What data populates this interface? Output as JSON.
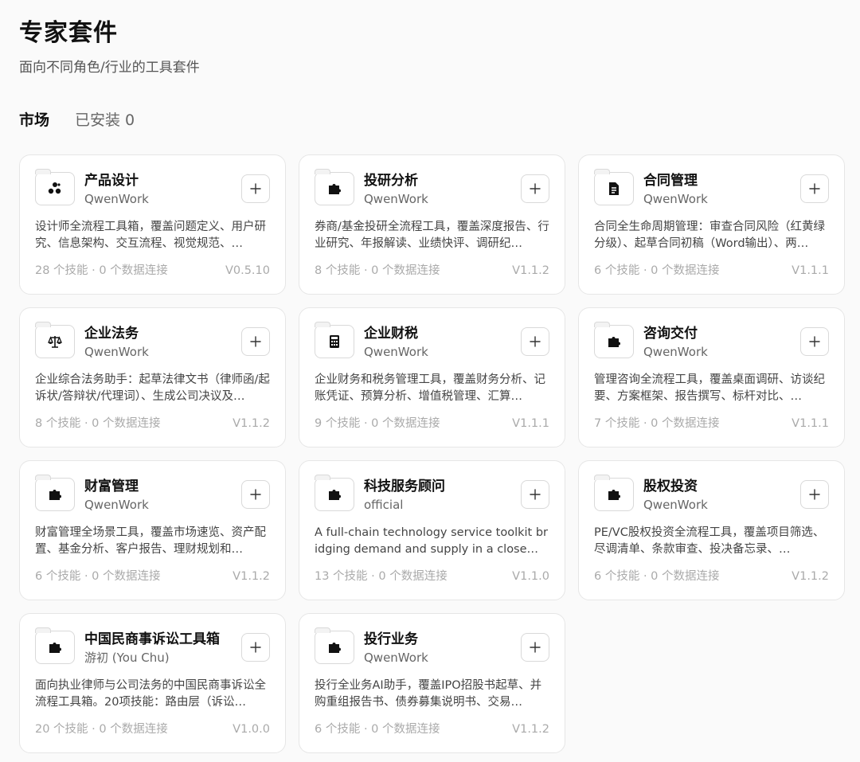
{
  "page": {
    "title": "专家套件",
    "subtitle": "面向不同角色/行业的工具套件"
  },
  "tabs": [
    {
      "label": "市场",
      "count": ""
    },
    {
      "label": "已安装",
      "count": "0"
    }
  ],
  "cards": [
    {
      "title": "产品设计",
      "author": "QwenWork",
      "icon": "palette-icon",
      "description": "设计师全流程工具箱，覆盖问题定义、用户研究、信息架构、交互流程、视觉规范、…",
      "stats": "28 个技能 · 0 个数据连接",
      "version": "V0.5.10"
    },
    {
      "title": "投研分析",
      "author": "QwenWork",
      "icon": "puzzle-icon",
      "description": "券商/基金投研全流程工具，覆盖深度报告、行业研究、年报解读、业绩快评、调研纪…",
      "stats": "8 个技能 · 0 个数据连接",
      "version": "V1.1.2"
    },
    {
      "title": "合同管理",
      "author": "QwenWork",
      "icon": "document-icon",
      "description": "合同全生命周期管理：审查合同风险（红黄绿分级）、起草合同初稿（Word输出）、两…",
      "stats": "6 个技能 · 0 个数据连接",
      "version": "V1.1.1"
    },
    {
      "title": "企业法务",
      "author": "QwenWork",
      "icon": "scale-icon",
      "description": "企业综合法务助手：起草法律文书（律师函/起诉状/答辩状/代理词）、生成公司决议及…",
      "stats": "8 个技能 · 0 个数据连接",
      "version": "V1.1.2"
    },
    {
      "title": "企业财税",
      "author": "QwenWork",
      "icon": "calculator-icon",
      "description": "企业财务和税务管理工具，覆盖财务分析、记账凭证、预算分析、增值税管理、汇算…",
      "stats": "9 个技能 · 0 个数据连接",
      "version": "V1.1.1"
    },
    {
      "title": "咨询交付",
      "author": "QwenWork",
      "icon": "puzzle-icon",
      "description": "管理咨询全流程工具，覆盖桌面调研、访谈纪要、方案框架、报告撰写、标杆对比、…",
      "stats": "7 个技能 · 0 个数据连接",
      "version": "V1.1.1"
    },
    {
      "title": "财富管理",
      "author": "QwenWork",
      "icon": "puzzle-icon",
      "description": "财富管理全场景工具，覆盖市场速览、资产配置、基金分析、客户报告、理财规划和…",
      "stats": "6 个技能 · 0 个数据连接",
      "version": "V1.1.2"
    },
    {
      "title": "科技服务顾问",
      "author": "official",
      "icon": "puzzle-icon",
      "description": "A full-chain technology service toolkit bridging demand and supply in a close…",
      "stats": "13 个技能 · 0 个数据连接",
      "version": "V1.1.0"
    },
    {
      "title": "股权投资",
      "author": "QwenWork",
      "icon": "puzzle-icon",
      "description": "PE/VC股权投资全流程工具，覆盖项目筛选、尽调清单、条款审查、投决备忘录、…",
      "stats": "6 个技能 · 0 个数据连接",
      "version": "V1.1.2"
    },
    {
      "title": "中国民商事诉讼工具箱",
      "author": "游初 (You Chu)",
      "icon": "puzzle-icon",
      "description": "面向执业律师与公司法务的中国民商事诉讼全流程工具箱。20项技能：路由层（诉讼…",
      "stats": "20 个技能 · 0 个数据连接",
      "version": "V1.0.0"
    },
    {
      "title": "投行业务",
      "author": "QwenWork",
      "icon": "puzzle-icon",
      "description": "投行全业务AI助手，覆盖IPO招股书起草、并购重组报告书、债券募集说明书、交易…",
      "stats": "6 个技能 · 0 个数据连接",
      "version": "V1.1.2"
    }
  ]
}
